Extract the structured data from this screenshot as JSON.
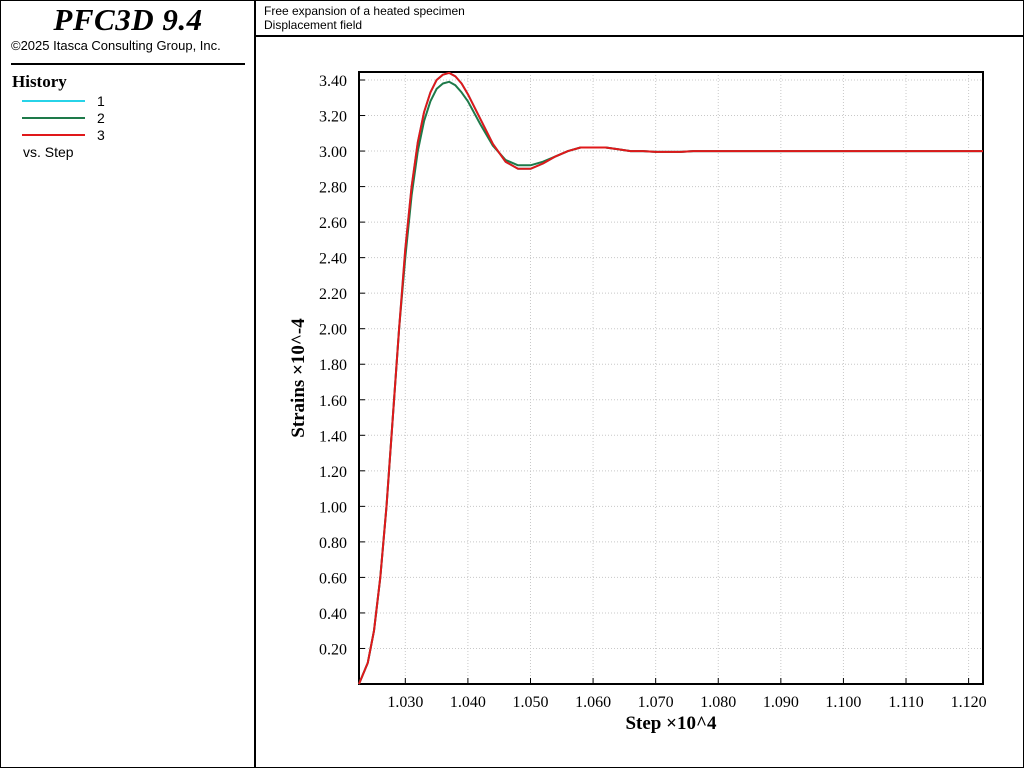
{
  "app": {
    "title": "PFC3D 9.4",
    "copyright": "©2025 Itasca Consulting Group, Inc."
  },
  "header": {
    "line1": "Free expansion of a heated specimen",
    "line2": "Displacement field"
  },
  "legend": {
    "title": "History",
    "items": [
      {
        "label": "1",
        "color": "#27d3e8"
      },
      {
        "label": "2",
        "color": "#1e7a4a"
      },
      {
        "label": "3",
        "color": "#e0181a"
      }
    ],
    "vs": "vs. Step"
  },
  "chart_data": {
    "type": "line",
    "xlabel": "Step ×10^4",
    "ylabel": "Strains ×10^-4",
    "xlim": [
      1.0226,
      1.1223
    ],
    "ylim": [
      0.0,
      3.445
    ],
    "xticks": [
      "1.030",
      "1.040",
      "1.050",
      "1.060",
      "1.070",
      "1.080",
      "1.090",
      "1.100",
      "1.110",
      "1.120"
    ],
    "yticks": [
      "0.20",
      "0.40",
      "0.60",
      "0.80",
      "1.00",
      "1.20",
      "1.40",
      "1.60",
      "1.80",
      "2.00",
      "2.20",
      "2.40",
      "2.60",
      "2.80",
      "3.00",
      "3.20",
      "3.40"
    ],
    "grid": true,
    "series": [
      {
        "name": "1",
        "color": "#27d3e8",
        "x": [
          1.0226,
          1.024,
          1.025,
          1.026,
          1.027,
          1.028,
          1.029,
          1.03,
          1.031,
          1.032,
          1.033,
          1.034,
          1.035,
          1.036,
          1.037,
          1.038,
          1.039,
          1.04,
          1.042,
          1.044,
          1.046,
          1.048,
          1.05,
          1.052,
          1.054,
          1.056,
          1.058,
          1.06,
          1.062,
          1.064,
          1.066,
          1.068,
          1.07,
          1.072,
          1.074,
          1.076,
          1.078,
          1.08,
          1.085,
          1.09,
          1.1,
          1.11,
          1.1223
        ],
        "y": [
          0.0,
          0.12,
          0.3,
          0.6,
          1.0,
          1.5,
          2.0,
          2.45,
          2.8,
          3.05,
          3.22,
          3.33,
          3.4,
          3.43,
          3.44,
          3.42,
          3.38,
          3.32,
          3.18,
          3.04,
          2.94,
          2.9,
          2.9,
          2.93,
          2.97,
          3.0,
          3.02,
          3.02,
          3.02,
          3.01,
          3.0,
          3.0,
          2.995,
          2.995,
          2.995,
          3.0,
          3.0,
          3.0,
          3.0,
          3.0,
          3.0,
          3.0,
          3.0
        ]
      },
      {
        "name": "2",
        "color": "#1e7a4a",
        "x": [
          1.0226,
          1.024,
          1.025,
          1.026,
          1.027,
          1.028,
          1.029,
          1.03,
          1.031,
          1.032,
          1.033,
          1.034,
          1.035,
          1.036,
          1.037,
          1.038,
          1.039,
          1.04,
          1.042,
          1.044,
          1.046,
          1.048,
          1.05,
          1.052,
          1.054,
          1.056,
          1.058,
          1.06,
          1.062,
          1.064,
          1.066,
          1.068,
          1.07,
          1.072,
          1.074,
          1.076,
          1.078,
          1.08,
          1.085,
          1.09,
          1.1,
          1.11,
          1.1223
        ],
        "y": [
          0.0,
          0.12,
          0.3,
          0.6,
          1.0,
          1.5,
          2.0,
          2.4,
          2.75,
          3.0,
          3.17,
          3.28,
          3.35,
          3.38,
          3.39,
          3.37,
          3.33,
          3.28,
          3.15,
          3.03,
          2.95,
          2.92,
          2.92,
          2.94,
          2.97,
          3.0,
          3.02,
          3.02,
          3.02,
          3.01,
          3.0,
          3.0,
          2.995,
          2.995,
          2.995,
          3.0,
          3.0,
          3.0,
          3.0,
          3.0,
          3.0,
          3.0,
          3.0
        ]
      },
      {
        "name": "3",
        "color": "#e0181a",
        "x": [
          1.0226,
          1.024,
          1.025,
          1.026,
          1.027,
          1.028,
          1.029,
          1.03,
          1.031,
          1.032,
          1.033,
          1.034,
          1.035,
          1.036,
          1.037,
          1.038,
          1.039,
          1.04,
          1.042,
          1.044,
          1.046,
          1.048,
          1.05,
          1.052,
          1.054,
          1.056,
          1.058,
          1.06,
          1.062,
          1.064,
          1.066,
          1.068,
          1.07,
          1.072,
          1.074,
          1.076,
          1.078,
          1.08,
          1.085,
          1.09,
          1.1,
          1.11,
          1.1223
        ],
        "y": [
          0.0,
          0.12,
          0.3,
          0.6,
          1.0,
          1.5,
          2.0,
          2.45,
          2.8,
          3.05,
          3.22,
          3.33,
          3.4,
          3.43,
          3.44,
          3.42,
          3.38,
          3.32,
          3.18,
          3.04,
          2.94,
          2.9,
          2.9,
          2.93,
          2.97,
          3.0,
          3.02,
          3.02,
          3.02,
          3.01,
          3.0,
          3.0,
          2.995,
          2.995,
          2.995,
          3.0,
          3.0,
          3.0,
          3.0,
          3.0,
          3.0,
          3.0,
          3.0
        ]
      }
    ]
  }
}
